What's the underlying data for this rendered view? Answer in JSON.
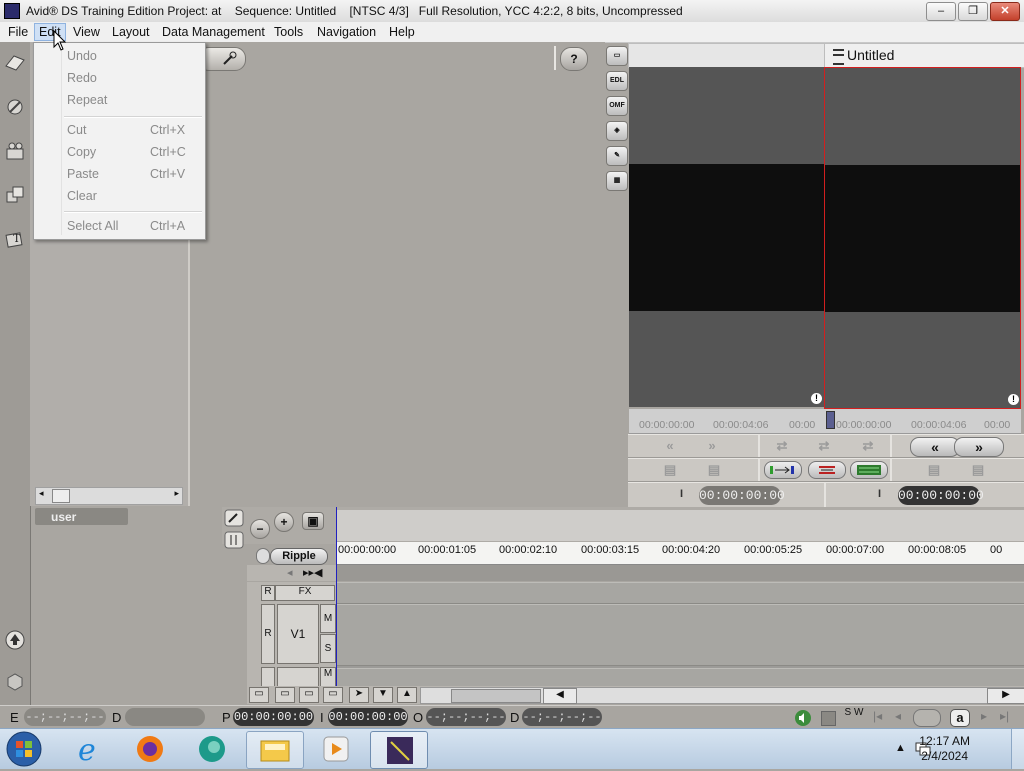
{
  "window": {
    "title": "Avid® DS Training Edition Project: at    Sequence: Untitled    [NTSC 4/3]   Full Resolution, YCC 4:2:2, 8 bits, Uncompressed",
    "controls": {
      "minimize": "–",
      "maximize": "❐",
      "close": "✕"
    }
  },
  "menubar": {
    "items": [
      "File",
      "Edit",
      "View",
      "Layout",
      "Data Management",
      "Tools",
      "Navigation",
      "Help"
    ],
    "open_menu": "Edit"
  },
  "edit_menu": {
    "items": [
      {
        "label": "Undo",
        "shortcut": ""
      },
      {
        "label": "Redo",
        "shortcut": ""
      },
      {
        "label": "Repeat",
        "shortcut": ""
      },
      {
        "label": "Cut",
        "shortcut": "Ctrl+X"
      },
      {
        "label": "Copy",
        "shortcut": "Ctrl+C"
      },
      {
        "label": "Paste",
        "shortcut": "Ctrl+V"
      },
      {
        "label": "Clear",
        "shortcut": ""
      },
      {
        "label": "Select All",
        "shortcut": "Ctrl+A"
      }
    ]
  },
  "browser": {
    "user_tab": "user"
  },
  "toolbar": {
    "help": "?"
  },
  "right_icons": [
    "EDL",
    "OMF"
  ],
  "record_monitor": {
    "title": "Untitled"
  },
  "source_ruler": {
    "labels": [
      "00:00:00:00",
      "00:00:04:06",
      "00:00"
    ]
  },
  "record_ruler": {
    "labels": [
      "00:00:00:00",
      "00:00:04:06",
      "00:00"
    ]
  },
  "monitor_timecodes": {
    "source": "00:00:00:00",
    "record": "00:00:00:00",
    "mark": "I"
  },
  "timeline": {
    "ripple_label": "Ripple",
    "ruler_labels": [
      "00:00:00:00",
      "00:00:01:05",
      "00:00:02:10",
      "00:00:03:15",
      "00:00:04:20",
      "00:00:05:25",
      "00:00:07:00",
      "00:00:08:05",
      "00"
    ],
    "track": {
      "name": "V1",
      "rec": "R",
      "fx": "FX",
      "mute": "M",
      "solo": "S"
    }
  },
  "statusbar": {
    "fields": [
      {
        "label": "E",
        "value": "--;--;--;--"
      },
      {
        "label": "D",
        "value": ""
      },
      {
        "label": "P",
        "value": "00:00:00:00"
      },
      {
        "label": "I",
        "value": "00:00:00:00"
      },
      {
        "label": "O",
        "value": "--;--;--;--"
      },
      {
        "label": "D",
        "value": "--;--;--;--"
      }
    ],
    "sw_label": "S W"
  },
  "taskbar": {
    "time": "12:17 AM",
    "date": "2/4/2024"
  }
}
